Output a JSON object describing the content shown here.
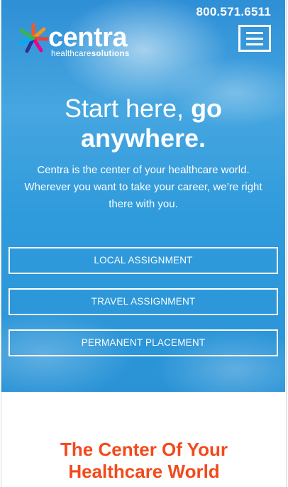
{
  "header": {
    "phone": "800.571.6511",
    "logo": {
      "name": "centra",
      "tagline_plain": "healthcare",
      "tagline_bold": "solutions"
    },
    "menu_icon": "hamburger-menu-icon"
  },
  "hero": {
    "headline_plain": "Start here,",
    "headline_bold_1": "go",
    "headline_bold_2": "anywhere.",
    "intro": "Centra is the center of your healthcare world. Wherever you want to take your career, we’re right there with you.",
    "buttons": [
      "LOCAL ASSIGNMENT",
      "TRAVEL ASSIGNMENT",
      "PERMANENT PLACEMENT"
    ]
  },
  "section": {
    "title_line1": "The Center Of Your",
    "title_line2": "Healthcare World"
  },
  "colors": {
    "sky": "#2f9bdc",
    "accent": "#f24a1c",
    "white": "#ffffff"
  }
}
